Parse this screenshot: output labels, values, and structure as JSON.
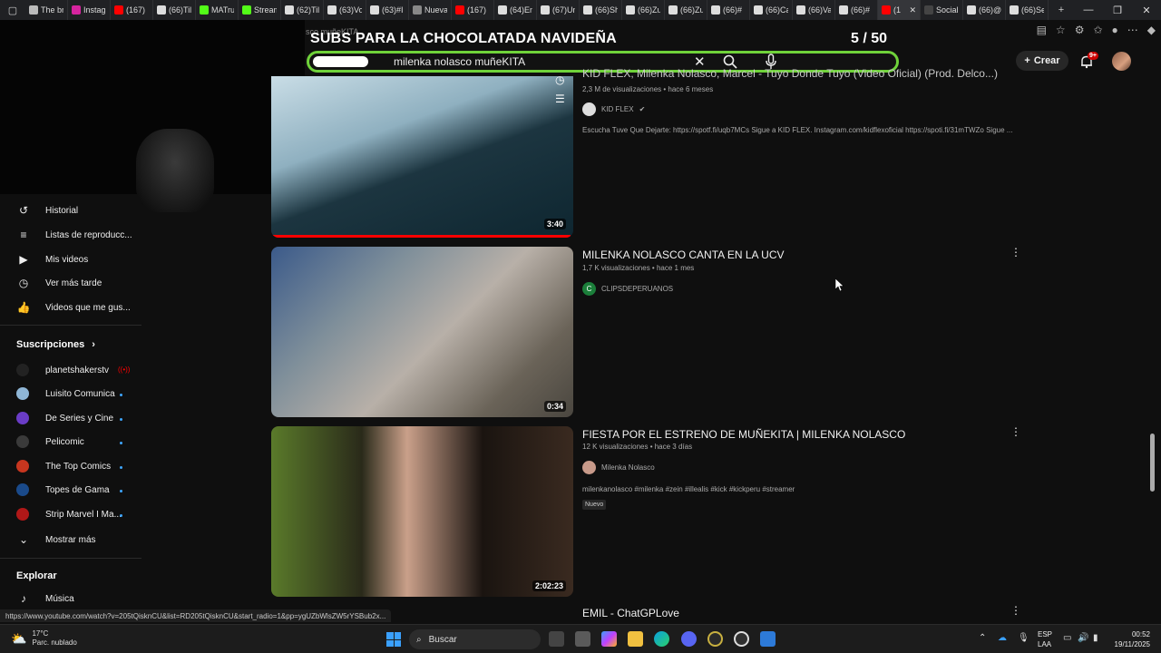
{
  "browser": {
    "tabs": [
      {
        "label": "The br",
        "color": "#bbbbbb"
      },
      {
        "label": "Instag",
        "color": "#d6249f"
      },
      {
        "label": "(167) ",
        "color": "#ff0000"
      },
      {
        "label": "(66)Til",
        "color": "#dddddd"
      },
      {
        "label": "MATru",
        "color": "#53fc18"
      },
      {
        "label": "Stream",
        "color": "#53fc18"
      },
      {
        "label": "(62)Til",
        "color": "#dddddd"
      },
      {
        "label": "(63)Vo",
        "color": "#dddddd"
      },
      {
        "label": "(63)#I",
        "color": "#dddddd"
      },
      {
        "label": "Nueva",
        "color": "#888888"
      },
      {
        "label": "(167) ",
        "color": "#ff0000"
      },
      {
        "label": "(64)En",
        "color": "#dddddd"
      },
      {
        "label": "(67)Un",
        "color": "#dddddd"
      },
      {
        "label": "(66)Sh",
        "color": "#dddddd"
      },
      {
        "label": "(66)Zu",
        "color": "#dddddd"
      },
      {
        "label": "(66)Zu",
        "color": "#dddddd"
      },
      {
        "label": "(66)#",
        "color": "#dddddd"
      },
      {
        "label": "(66)Ca",
        "color": "#dddddd"
      },
      {
        "label": "(66)Va",
        "color": "#dddddd"
      },
      {
        "label": "(66)#",
        "color": "#dddddd"
      },
      {
        "label": "(1",
        "color": "#ff0000",
        "active": true
      },
      {
        "label": "Social",
        "color": "#444444"
      },
      {
        "label": "(66)@",
        "color": "#dddddd"
      },
      {
        "label": "(66)Se",
        "color": "#dddddd"
      }
    ],
    "new_tab": "+",
    "close_tab": "✕",
    "minimize": "—",
    "maximize": "❐",
    "close": "✕",
    "url_ghost": "sco muñeKITA"
  },
  "overlay": {
    "banner": "SUBS PARA LA CHOCOLATADA NAVIDEÑA",
    "counter": "5  / 50"
  },
  "search": {
    "query": "milenka nolasco muñeKITA",
    "clear": "✕"
  },
  "header": {
    "create_label": "Crear",
    "notif_badge": "9+"
  },
  "sidebar": {
    "you_items": [
      {
        "label": "Historial",
        "icon": "history-icon",
        "glyph": "↺"
      },
      {
        "label": "Listas de reproducc...",
        "icon": "playlist-icon",
        "glyph": "≡"
      },
      {
        "label": "Mis videos",
        "icon": "my-videos-icon",
        "glyph": "▶"
      },
      {
        "label": "Ver más tarde",
        "icon": "watch-later-icon",
        "glyph": "◷"
      },
      {
        "label": "Videos que me gus...",
        "icon": "like-icon",
        "glyph": "👍"
      }
    ],
    "subs_heading": "Suscripciones",
    "subs_arrow": "›",
    "subscriptions": [
      {
        "label": "planetshakerstv",
        "color": "#222222",
        "live": true
      },
      {
        "label": "Luisito Comunica",
        "color": "#8fb6d6",
        "dot": true
      },
      {
        "label": "De Series y Cine",
        "color": "#6a3cc6",
        "dot": true
      },
      {
        "label": "Pelicomic",
        "color": "#3a3a3a",
        "dot": true
      },
      {
        "label": "The Top Comics",
        "color": "#c7361f",
        "dot": true
      },
      {
        "label": "Topes de Gama",
        "color": "#1a4a8a",
        "dot": true
      },
      {
        "label": "Strip Marvel I Ma...",
        "color": "#b01818",
        "dot": true
      }
    ],
    "live_glyph": "((•))",
    "show_more": "Mostrar más",
    "explore_heading": "Explorar",
    "explore_items": [
      {
        "label": "Música",
        "icon": "music-icon",
        "glyph": "♪"
      }
    ]
  },
  "results": [
    {
      "title": "KID FLEX, Milenka Nolasco, Marcel - Tuyo Donde Tuyo (Video Oficial) (Prod. Delco...)",
      "meta": "2,3 M de visualizaciones • hace 6 meses",
      "channel": "KID FLEX",
      "verified": "✔",
      "description": "Escucha Tuve Que Dejarte: https://spotf.fi/uqb7MCs Sigue a KID FLEX. Instagram.com/kidflexoficial https://spoti.fi/31mTWZo Sigue ...",
      "duration": "3:40",
      "watched_fraction": 0.99
    },
    {
      "title": "MILENKA NOLASCO CANTA EN LA UCV",
      "meta": "1,7 K visualizaciones • hace 1 mes",
      "channel": "CLIPSDEPERUANOS",
      "channel_initial": "C",
      "duration": "0:34"
    },
    {
      "title": "FIESTA POR EL ESTRENO DE MUÑEKITA | MILENKA NOLASCO",
      "meta": "12 K visualizaciones • hace 3 días",
      "channel": "Milenka Nolasco",
      "description": "milenkanolasco #milenka #zein #illealis #kick #kickperu #streamer",
      "badge": "Nuevo",
      "duration": "2:02:23"
    },
    {
      "title": "EMIL - ChatGPLove"
    }
  ],
  "status_url": "https://www.youtube.com/watch?v=205tQisknCU&list=RD205tQisknCU&start_radio=1&pp=ygUZbWlsZW5rYSBub2x...",
  "taskbar": {
    "temp": "17°C",
    "weather": "Parc. nublado",
    "search_label": "Buscar",
    "lang1": "ESP",
    "lang2": "LAA",
    "time": "00:52",
    "date": "19/11/2025"
  }
}
